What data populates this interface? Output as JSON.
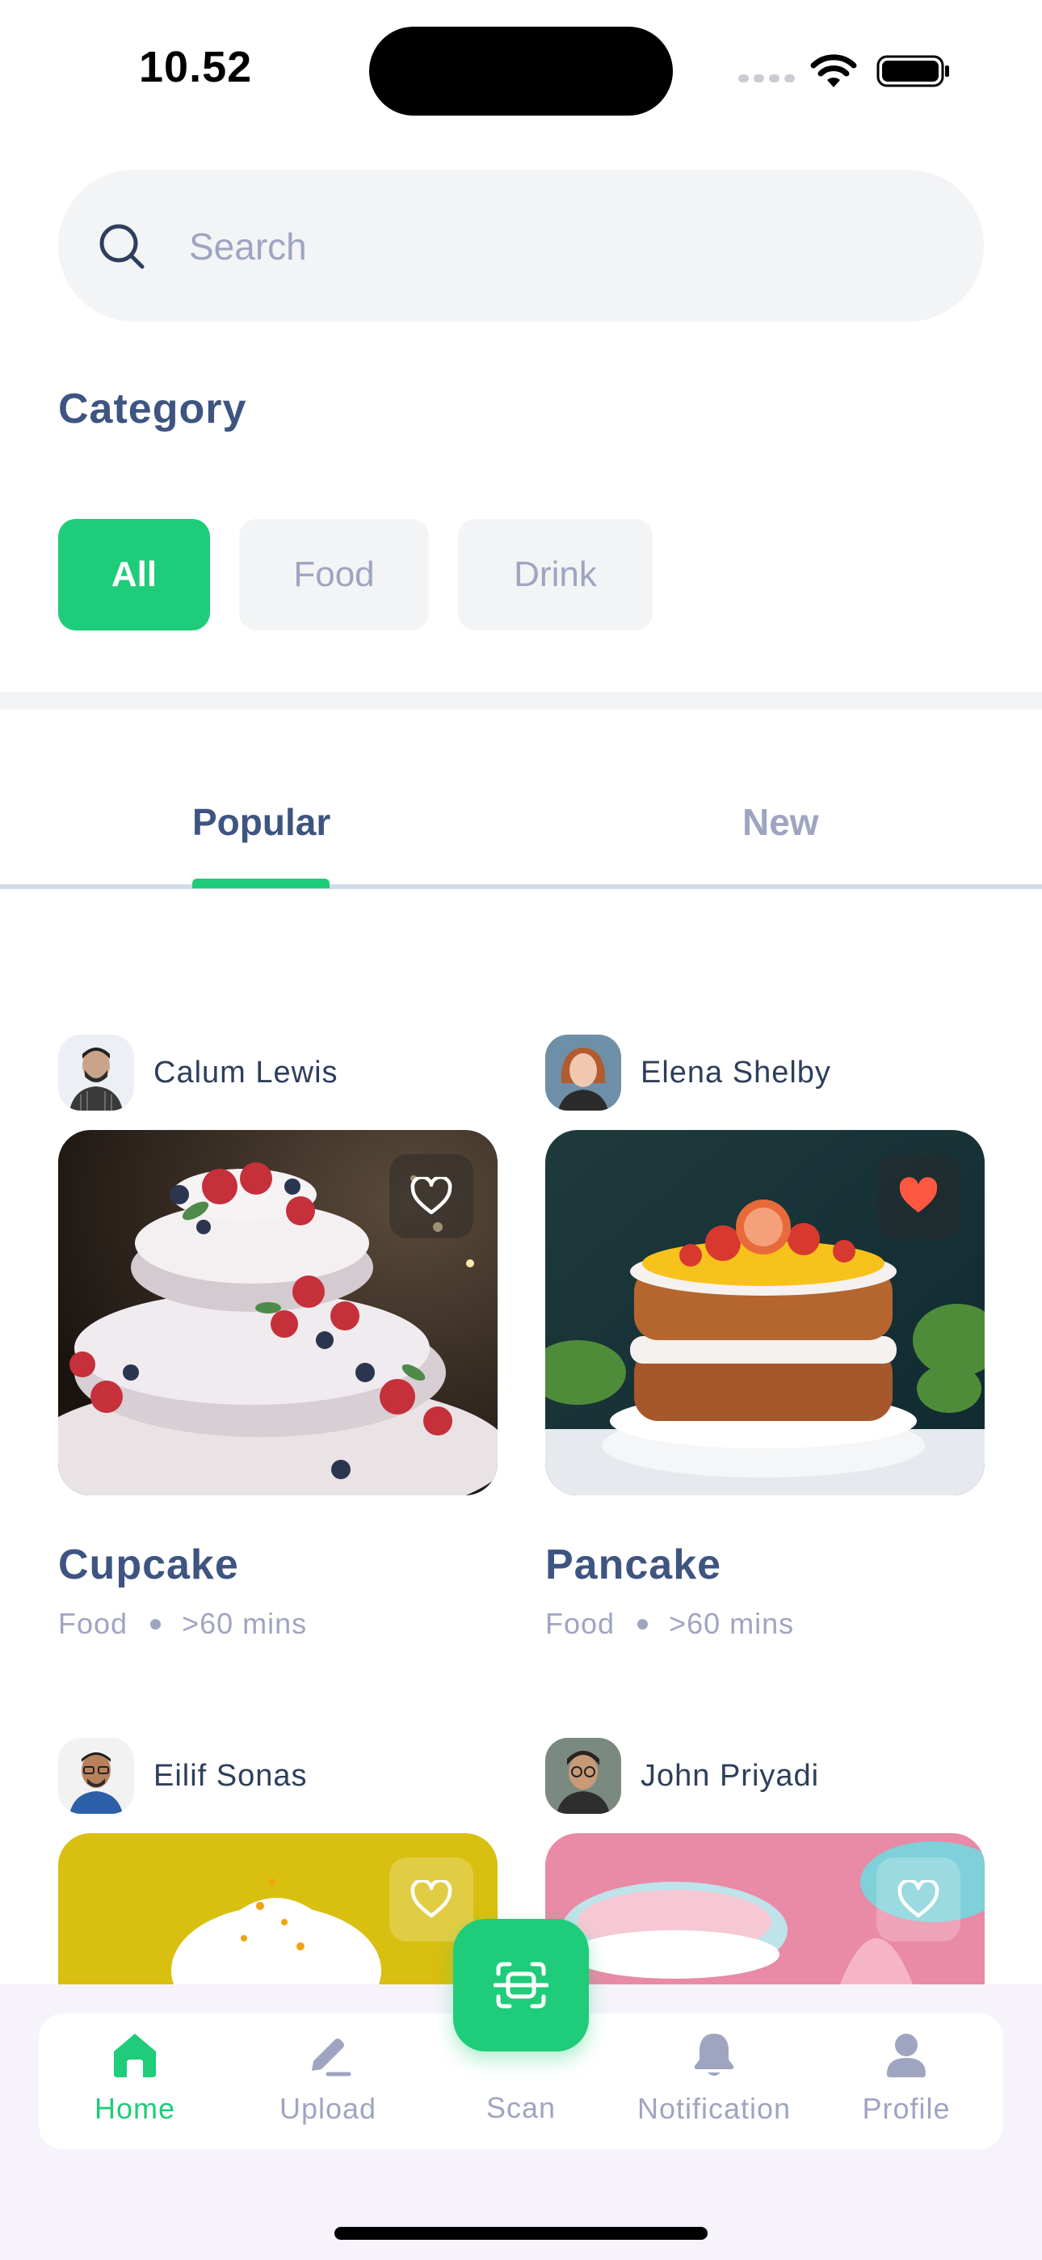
{
  "status_bar": {
    "time": "10.52"
  },
  "search": {
    "placeholder": "Search"
  },
  "category": {
    "title": "Category",
    "chips": [
      "All",
      "Food",
      "Drink"
    ],
    "selected": "All"
  },
  "tabs": {
    "popular": "Popular",
    "new": "New",
    "selected": "Popular"
  },
  "recipes": [
    {
      "author": "Calum Lewis",
      "title": "Cupcake",
      "category": "Food",
      "time": ">60 mins",
      "favorited": false
    },
    {
      "author": "Elena Shelby",
      "title": "Pancake",
      "category": "Food",
      "time": ">60 mins",
      "favorited": true
    },
    {
      "author": "Eilif Sonas",
      "favorited": false
    },
    {
      "author": "John Priyadi",
      "favorited": false
    }
  ],
  "nav": {
    "home": "Home",
    "upload": "Upload",
    "scan": "Scan",
    "notification": "Notification",
    "profile": "Profile",
    "active": "Home"
  },
  "colors": {
    "primary": "#1fcc79",
    "heading": "#3e5481",
    "muted": "#9fa5c0",
    "chip_bg": "#f3f4f6",
    "heart_active": "#ff5842"
  },
  "icons": {
    "search": "search-icon",
    "favorite": "heart-icon",
    "home": "home-icon",
    "upload": "pencil-icon",
    "scan": "scan-icon",
    "notification": "bell-icon",
    "profile": "user-icon"
  }
}
